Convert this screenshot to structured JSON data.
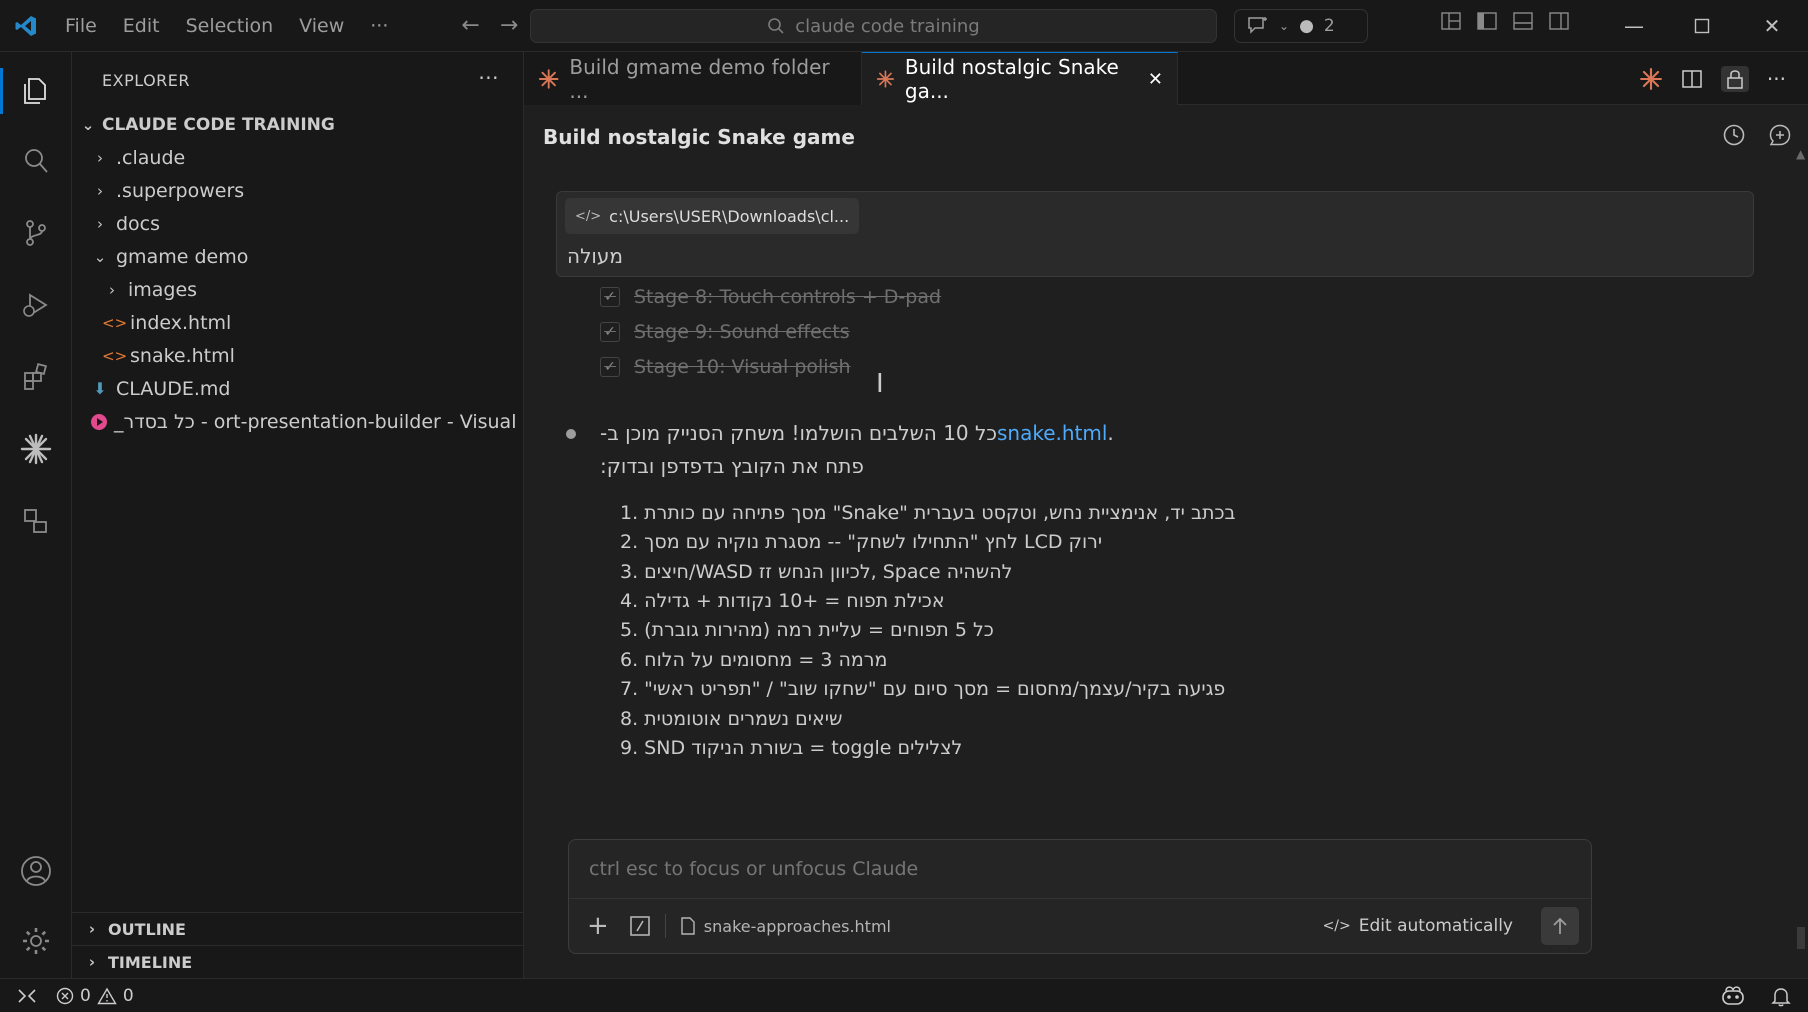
{
  "titlebar": {
    "menu": [
      "File",
      "Edit",
      "Selection",
      "View",
      "···"
    ],
    "search_text": "claude code training",
    "chat_count": "2"
  },
  "sidebar": {
    "header": "EXPLORER",
    "root": "CLAUDE CODE TRAINING",
    "items": [
      {
        "label": ".claude",
        "type": "folder"
      },
      {
        "label": ".superpowers",
        "type": "folder"
      },
      {
        "label": "docs",
        "type": "folder"
      },
      {
        "label": "gmame demo",
        "type": "folder-open"
      },
      {
        "label": "images",
        "type": "folder"
      },
      {
        "label": "index.html",
        "type": "html"
      },
      {
        "label": "snake.html",
        "type": "html"
      },
      {
        "label": "CLAUDE.md",
        "type": "md"
      },
      {
        "label": "_כל בסדר - ort-presentation-builder - Visual ...",
        "type": "ref"
      }
    ],
    "outline": "OUTLINE",
    "timeline": "TIMELINE"
  },
  "tabs": [
    {
      "label": "Build gmame demo folder ...",
      "active": false
    },
    {
      "label": "Build nostalgic Snake ga...",
      "active": true
    }
  ],
  "panel": {
    "title": "Build nostalgic Snake game",
    "context_chip": "c:\\Users\\USER\\Downloads\\cl...",
    "context_text": "מעולה",
    "done_items": [
      "Stage 8: Touch controls + D-pad",
      "Stage 9: Sound effects",
      "Stage 10: Visual polish"
    ],
    "message_line1_text": "כל 10 השלבים הושלמו! משחק הסנייק מוכן ב-",
    "message_line1_link": "snake.html",
    "message_line1_end": ".",
    "message_line2": "פתח את הקובץ בדפדפן ובדוק:",
    "list": [
      "1. מסך פתיחה עם כותרת \"Snake\" בכתב יד, אנימציית נחש, וטקסט בעברית",
      "2. לחץ \"התחילו לשחק\" -- מסגרת נוקיה עם מסך LCD ירוק",
      "3. חיצים/WASD לכיוון הנחש זז, Space להשהיה",
      "4. אכילת תפוח = +10 נקודות + גדילה",
      "5. כל 5 תפוחים = עליית רמה (מהירות גוברת)",
      "6. מרמה 3 = מחסומים על הלוח",
      "7. \"פגיעה בקיר/עצמך/מחסום = מסך סיום עם \"שחקו שוב\" / \"תפריט ראשי",
      "8. שיאים נשמרים אוטומטית",
      "9. SND בשורת הניקוד = toggle לצלילים"
    ],
    "input_placeholder": "ctrl esc to focus or unfocus Claude",
    "file_chip": "snake-approaches.html",
    "edit_mode": "Edit automatically"
  },
  "statusbar": {
    "errors": "0",
    "warnings": "0"
  },
  "colors": {
    "accent": "#0078d4",
    "link": "#4daafc",
    "claude": "#d97757"
  }
}
